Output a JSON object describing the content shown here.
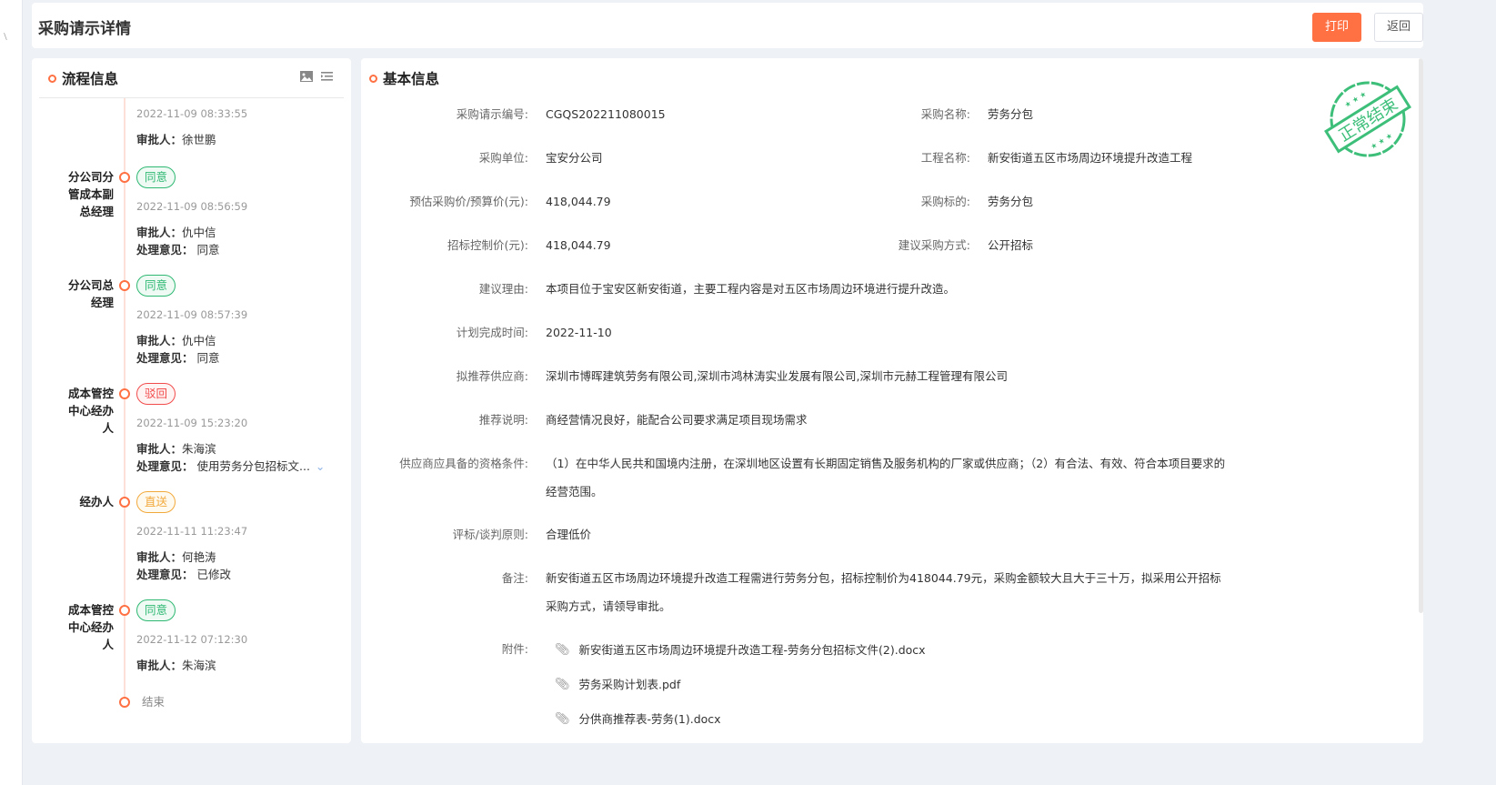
{
  "header": {
    "title": "采购请示详情",
    "print": "打印",
    "back": "返回"
  },
  "flow": {
    "title": "流程信息",
    "icons": [
      "image-icon",
      "list-icon"
    ],
    "approver_label": "审批人：",
    "opinion_label": "处理意见：",
    "first": {
      "date": "2022-11-09 08:33:55",
      "approver": "徐世鹏"
    },
    "items": [
      {
        "role": "分公司分管成本副总经理",
        "status": "同意",
        "kind": "ok",
        "date": "2022-11-09 08:56:59",
        "approver": "仇中信",
        "opinion": "同意"
      },
      {
        "role": "分公司总经理",
        "status": "同意",
        "kind": "ok",
        "date": "2022-11-09 08:57:39",
        "approver": "仇中信",
        "opinion": "同意"
      },
      {
        "role": "成本管控中心经办人",
        "status": "驳回",
        "kind": "rej",
        "date": "2022-11-09 15:23:20",
        "approver": "朱海滨",
        "opinion": "使用劳务分包招标文..."
      },
      {
        "role": "经办人",
        "status": "直送",
        "kind": "dir",
        "date": "2022-11-11 11:23:47",
        "approver": "何艳涛",
        "opinion": "已修改"
      },
      {
        "role": "成本管控中心经办人",
        "status": "同意",
        "kind": "ok",
        "date": "2022-11-12 07:12:30",
        "approver": "朱海滨"
      }
    ],
    "end": "结束"
  },
  "basic": {
    "title": "基本信息",
    "stamp": "正常结束",
    "fields": {
      "code": {
        "k": "采购请示编号:",
        "v": "CGQS202211080015"
      },
      "name": {
        "k": "采购名称:",
        "v": "劳务分包"
      },
      "unit": {
        "k": "采购单位:",
        "v": "宝安分公司"
      },
      "project": {
        "k": "工程名称:",
        "v": "新安街道五区市场周边环境提升改造工程"
      },
      "budget": {
        "k": "预估采购价/预算价(元):",
        "v": "418,044.79"
      },
      "target": {
        "k": "采购标的:",
        "v": "劳务分包"
      },
      "control": {
        "k": "招标控制价(元):",
        "v": "418,044.79"
      },
      "method": {
        "k": "建议采购方式:",
        "v": "公开招标"
      },
      "reason": {
        "k": "建议理由:",
        "v": "本项目位于宝安区新安街道，主要工程内容是对五区市场周边环境进行提升改造。"
      },
      "plan_date": {
        "k": "计划完成时间:",
        "v": "2022-11-10"
      },
      "suppliers": {
        "k": "拟推荐供应商:",
        "v": "深圳市博晖建筑劳务有限公司,深圳市鸿林涛实业发展有限公司,深圳市元赫工程管理有限公司"
      },
      "rec_note": {
        "k": "推荐说明:",
        "v": "商经营情况良好，能配合公司要求满足项目现场需求"
      },
      "qualify": {
        "k": "供应商应具备的资格条件:",
        "v": "（1）在中华人民共和国境内注册，在深圳地区设置有长期固定销售及服务机构的厂家或供应商；（2）有合法、有效、符合本项目要求的经营范围。"
      },
      "principle": {
        "k": "评标/谈判原则:",
        "v": "合理低价"
      },
      "remark": {
        "k": "备注:",
        "v": "新安街道五区市场周边环境提升改造工程需进行劳务分包，招标控制价为418044.79元，采购金额较大且大于三十万，拟采用公开招标采购方式，请领导审批。"
      },
      "attach": {
        "k": "附件:"
      }
    },
    "attachments": [
      "新安街道五区市场周边环境提升改造工程-劳务分包招标文件(2).docx",
      "劳务采购计划表.pdf",
      "分供商推荐表-劳务(1).docx"
    ]
  },
  "colors": {
    "accent": "#ff7043",
    "ok": "#2eb872",
    "reject": "#f24b4b",
    "direct": "#f2a93b",
    "stamp": "#3dbf7a"
  }
}
